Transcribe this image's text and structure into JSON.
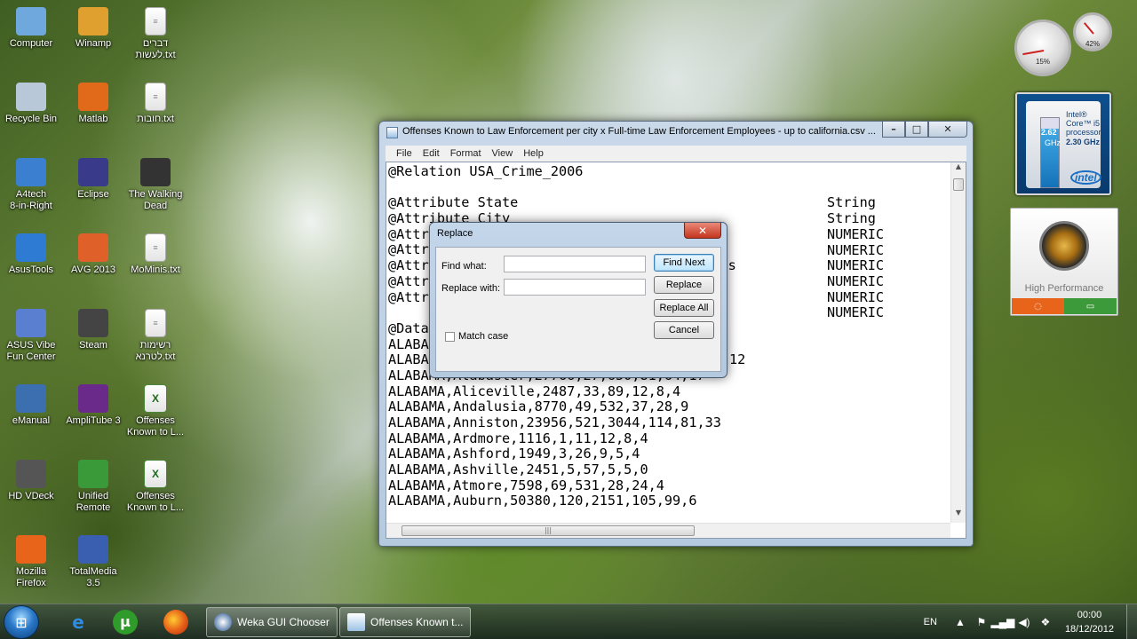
{
  "desktop_icons": [
    {
      "label": "Computer",
      "icon": "computer-icon"
    },
    {
      "label": "Winamp",
      "icon": "winamp-icon"
    },
    {
      "label": "דברים\nלעשות.txt",
      "icon": "text-file-icon"
    },
    {
      "label": "Recycle Bin",
      "icon": "recycle-bin-icon"
    },
    {
      "label": "Matlab",
      "icon": "matlab-icon"
    },
    {
      "label": "חובות.txt",
      "icon": "text-file-icon"
    },
    {
      "label": "A4tech\n8-in-Right",
      "icon": "a4tech-icon"
    },
    {
      "label": "Eclipse",
      "icon": "eclipse-icon"
    },
    {
      "label": "The Walking\nDead",
      "icon": "walking-dead-icon"
    },
    {
      "label": "AsusTools",
      "icon": "asustools-icon"
    },
    {
      "label": "AVG 2013",
      "icon": "avg-icon"
    },
    {
      "label": "MoMinis.txt",
      "icon": "text-file-icon"
    },
    {
      "label": "ASUS Vibe\nFun Center",
      "icon": "asus-vibe-icon"
    },
    {
      "label": "Steam",
      "icon": "steam-icon"
    },
    {
      "label": "רשימות\nלטרנא.txt",
      "icon": "text-file-icon"
    },
    {
      "label": "eManual",
      "icon": "emanual-icon"
    },
    {
      "label": "AmpliTube 3",
      "icon": "amplitube-icon"
    },
    {
      "label": "Offenses\nKnown to L...",
      "icon": "excel-file-icon"
    },
    {
      "label": "HD VDeck",
      "icon": "hd-vdeck-icon"
    },
    {
      "label": "Unified\nRemote",
      "icon": "unified-remote-icon"
    },
    {
      "label": "Offenses\nKnown to L...",
      "icon": "excel-file-icon"
    },
    {
      "label": "Mozilla\nFirefox",
      "icon": "firefox-icon"
    },
    {
      "label": "TotalMedia\n3.5",
      "icon": "totalmedia-icon"
    }
  ],
  "gadgets": {
    "cpu_meter": {
      "cpu": "15%",
      "memory": "42%"
    },
    "intel": {
      "brand": "Intel®",
      "line1": "Core™ i5",
      "line2": "processor",
      "freq": "2.30 GHz",
      "current": "2.62",
      "unit": "GHz",
      "logo": "intel",
      "level": 0.85
    },
    "power": {
      "label": "High Performance"
    }
  },
  "notepad": {
    "title": "Offenses Known to Law Enforcement per city x Full-time Law Enforcement Employees - up to california.csv ...",
    "menu": [
      "File",
      "Edit",
      "Format",
      "View",
      "Help"
    ],
    "lines": [
      "@Relation USA_Crime_2006",
      "",
      "@Attribute State",
      "@Attribute City",
      "@Attr",
      "@Attr",
      "@Attr",
      "@Attr",
      "@Attr",
      "",
      "@Data",
      "ALABAMA,",
      "ALABAMA,",
      "ALABAMA,Alabaster,27766,27,650,81,64,17",
      "ALABAMA,Aliceville,2487,33,89,12,8,4",
      "ALABAMA,Andalusia,8770,49,532,37,28,9",
      "ALABAMA,Anniston,23956,521,3044,114,81,33",
      "ALABAMA,Ardmore,1116,1,11,12,8,4",
      "ALABAMA,Ashford,1949,3,26,9,5,4",
      "ALABAMA,Ashville,2451,5,57,5,5,0",
      "ALABAMA,Atmore,7598,69,531,28,24,4",
      "ALABAMA,Auburn,50380,120,2151,105,99,6"
    ],
    "types": [
      "String",
      "String",
      "NUMERIC",
      "NUMERIC",
      "NUMERIC",
      "NUMERIC",
      "NUMERIC",
      "NUMERIC"
    ],
    "partial_1": "oyees",
    "partial_2": "12"
  },
  "replace_dialog": {
    "title": "Replace",
    "find_label": "Find what:",
    "find_value": "",
    "replace_label": "Replace with:",
    "replace_value": "",
    "match_case_label": "Match case",
    "buttons": {
      "find_next": "Find Next",
      "replace": "Replace",
      "replace_all": "Replace All",
      "cancel": "Cancel"
    }
  },
  "taskbar": {
    "pinned": [
      "internet-explorer-icon",
      "utorrent-icon",
      "firefox-icon"
    ],
    "tasks": [
      {
        "label": "Weka GUI Chooser",
        "icon": "weka-icon"
      },
      {
        "label": "Offenses Known t...",
        "icon": "notepad-icon"
      }
    ],
    "language": "EN",
    "time": "00:00",
    "date": "18/12/2012"
  }
}
